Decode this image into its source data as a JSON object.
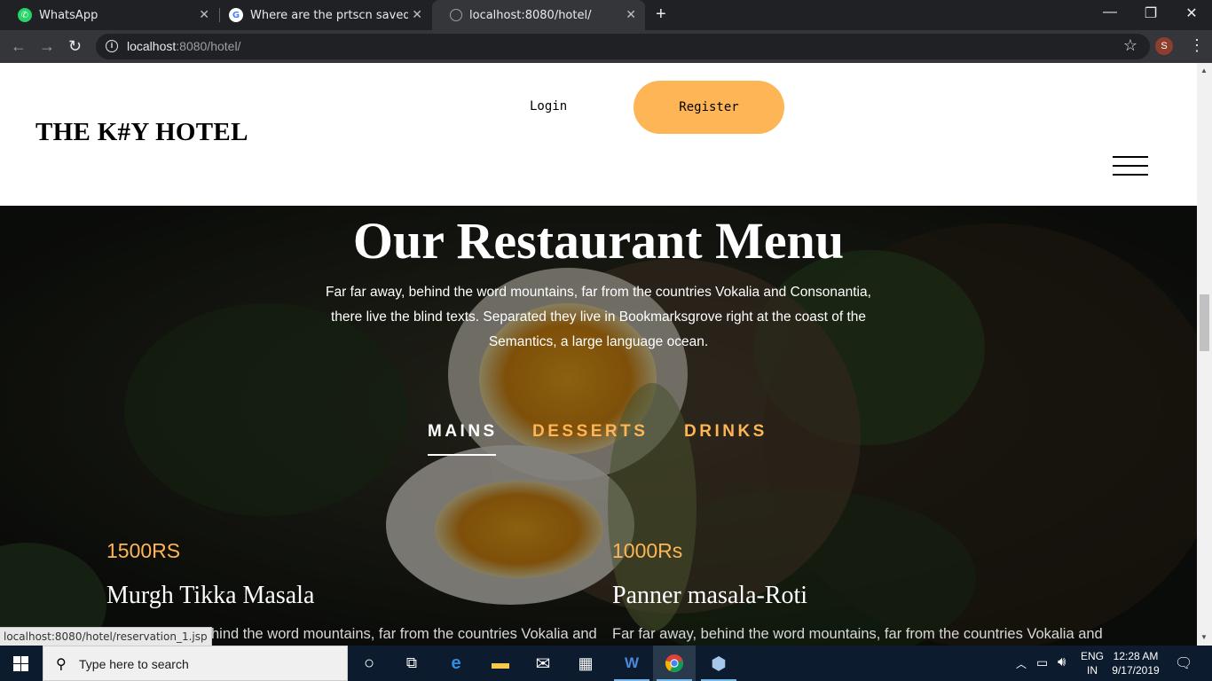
{
  "browser": {
    "tabs": [
      {
        "title": "WhatsApp",
        "icon": "whatsapp-icon",
        "active": false
      },
      {
        "title": "Where are the prtscn saved in Wi",
        "icon": "google-icon",
        "active": false
      },
      {
        "title": "localhost:8080/hotel/",
        "icon": "globe-icon",
        "active": true
      }
    ],
    "url_host": "localhost",
    "url_rest": ":8080/hotel/",
    "profile_initial": "S",
    "status_url": "localhost:8080/hotel/reservation_1.jsp"
  },
  "header": {
    "logo": "THE K#Y HOTEL",
    "login_label": "Login",
    "register_label": "Register"
  },
  "hero": {
    "title": "Our Restaurant Menu",
    "text": "Far far away, behind the word mountains, far from the countries Vokalia and Consonantia, there live the blind texts. Separated they live in Bookmarksgrove right at the coast of the Semantics, a large language ocean.",
    "tabs": [
      "MAINS",
      "DESSERTS",
      "DRINKS"
    ],
    "selected_tab": "MAINS"
  },
  "dishes": [
    {
      "price": "1500RS",
      "name": "Murgh Tikka Masala",
      "desc": "Far far away, behind the word mountains, far from the countries Vokalia and Consonantia, there live the blind texts."
    },
    {
      "price": "1000Rs",
      "name": "Panner masala-Roti",
      "desc": "Far far away, behind the word mountains, far from the countries Vokalia and Consonantia, there live the blind texts."
    }
  ],
  "taskbar": {
    "search_placeholder": "Type here to search",
    "lang_top": "ENG",
    "lang_bottom": "IN",
    "time": "12:28 AM",
    "date": "9/17/2019"
  },
  "colors": {
    "accent": "#fdb555",
    "chrome_dark": "#202124",
    "taskbar": "#0c1b2d"
  }
}
